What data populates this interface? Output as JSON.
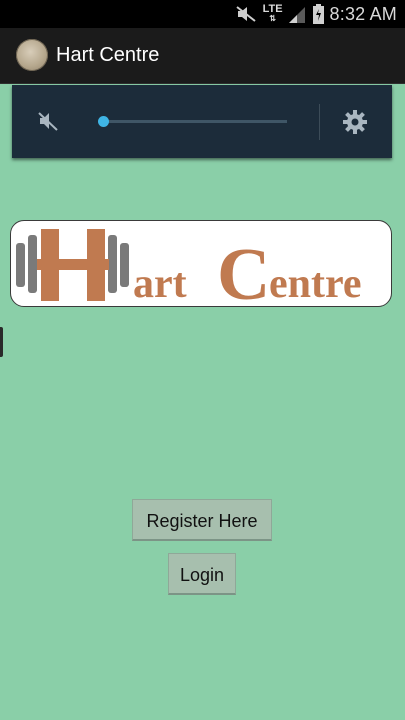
{
  "status_bar": {
    "network": "LTE",
    "time": "8:32 AM"
  },
  "action_bar": {
    "title": "Hart Centre"
  },
  "volume_panel": {
    "level": 0.0,
    "icons": [
      "mute-icon",
      "settings-gear-icon"
    ]
  },
  "logo": {
    "text_h": "H",
    "text_art": "art",
    "text_c": "C",
    "text_entre": "entre",
    "brand_color": "#c07a50"
  },
  "buttons": {
    "register_label": "Register Here",
    "login_label": "Login"
  }
}
